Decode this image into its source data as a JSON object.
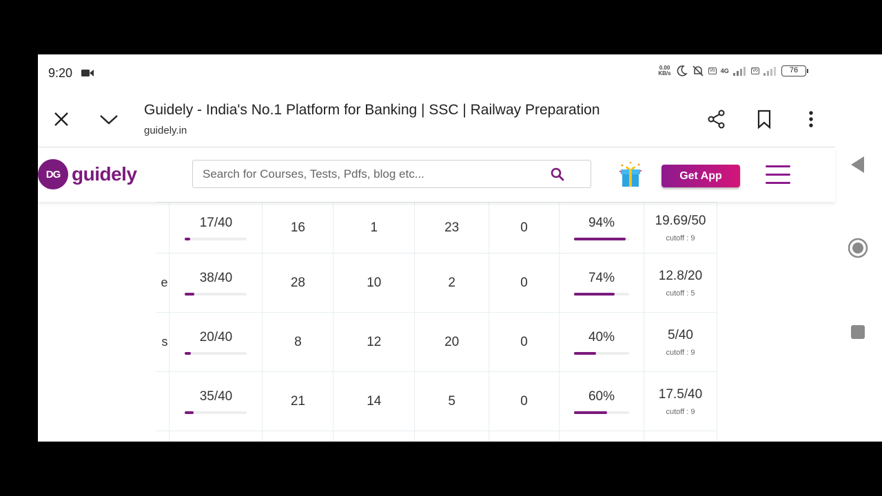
{
  "status_bar": {
    "time": "9:20",
    "net_speed_value": "0.00",
    "net_speed_unit": "KB/s",
    "signal_label": "4G",
    "battery": "76"
  },
  "browser": {
    "page_title": "Guidely - India's No.1 Platform for Banking | SSC | Railway Preparation",
    "url": "guidely.in"
  },
  "site_header": {
    "logo_text": "guidely",
    "logo_badge": "DG",
    "search_placeholder": "Search for Courses, Tests, Pdfs, blog etc...",
    "get_app_label": "Get App"
  },
  "table": {
    "rows": [
      {
        "name": "",
        "attempted": "17/40",
        "attempted_frac": 0.0875,
        "correct": "16",
        "incorrect": "1",
        "skipped": "23",
        "unseen": "0",
        "accuracy": "94%",
        "accuracy_frac": 0.94,
        "score": "19.69/50",
        "cutoff": "cutoff : 9"
      },
      {
        "name": "e",
        "attempted": "38/40",
        "attempted_frac": 0.15,
        "correct": "28",
        "incorrect": "10",
        "skipped": "2",
        "unseen": "0",
        "accuracy": "74%",
        "accuracy_frac": 0.74,
        "score": "12.8/20",
        "cutoff": "cutoff : 5"
      },
      {
        "name": "s",
        "attempted": "20/40",
        "attempted_frac": 0.09,
        "correct": "8",
        "incorrect": "12",
        "skipped": "20",
        "unseen": "0",
        "accuracy": "40%",
        "accuracy_frac": 0.4,
        "score": "5/40",
        "cutoff": "cutoff : 9"
      },
      {
        "name": "",
        "attempted": "35/40",
        "attempted_frac": 0.14,
        "correct": "21",
        "incorrect": "14",
        "skipped": "5",
        "unseen": "0",
        "accuracy": "60%",
        "accuracy_frac": 0.6,
        "score": "17.5/40",
        "cutoff": "cutoff : 9"
      }
    ]
  },
  "colors": {
    "brand": "#7b1a7d",
    "get_app_gradient_start": "#8e1a8e",
    "get_app_gradient_end": "#d3157a"
  }
}
